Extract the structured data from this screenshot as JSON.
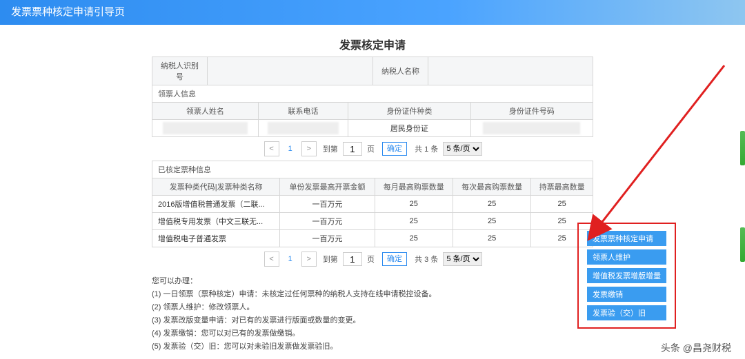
{
  "header": {
    "title": "发票票种核定申请引导页"
  },
  "main": {
    "title": "发票核定申请",
    "taxpayer_row": {
      "id_label": "纳税人识别号",
      "id_value": "",
      "name_label": "纳税人名称",
      "name_value": ""
    },
    "recipient": {
      "section_title": "领票人信息",
      "cols": [
        "领票人姓名",
        "联系电话",
        "身份证件种类",
        "身份证件号码"
      ],
      "row": {
        "name": "",
        "phone": "",
        "id_type": "居民身份证",
        "id_no": ""
      }
    },
    "pager1": {
      "prev": "<",
      "page_num": "1",
      "next": ">",
      "to_label": "到第",
      "to_value": "1",
      "page_unit": "页",
      "confirm": "确定",
      "total_text": "共 1 条",
      "per_page": "5 条/页"
    },
    "approved": {
      "section_title": "已核定票种信息",
      "cols": [
        "发票种类代码|发票种类名称",
        "单份发票最高开票金额",
        "每月最高购票数量",
        "每次最高购票数量",
        "持票最高数量"
      ],
      "rows": [
        {
          "c0": "2016版增值税普通发票（二联...",
          "c1": "一百万元",
          "c2": "25",
          "c3": "25",
          "c4": "25"
        },
        {
          "c0": "增值税专用发票（中文三联无...",
          "c1": "一百万元",
          "c2": "25",
          "c3": "25",
          "c4": "25"
        },
        {
          "c0": "增值税电子普通发票",
          "c1": "一百万元",
          "c2": "25",
          "c3": "25",
          "c4": "25"
        }
      ]
    },
    "pager2": {
      "prev": "<",
      "page_num": "1",
      "next": ">",
      "to_label": "到第",
      "to_value": "1",
      "page_unit": "页",
      "confirm": "确定",
      "total_text": "共 3 条",
      "per_page": "5 条/页"
    },
    "help": {
      "title": "您可以办理：",
      "lines": [
        "(1) 一日领票（票种核定）申请：未核定过任何票种的纳税人支持在线申请税控设备。",
        "(2) 领票人维护：修改领票人。",
        "(3) 发票改版变量申请：对已有的发票进行版面或数量的变更。",
        "(4) 发票缴销：您可以对已有的发票做缴销。",
        "(5) 发票验（交）旧：您可以对未验旧发票做发票验旧。"
      ]
    },
    "actions": {
      "items": [
        "发票票种核定申请",
        "领票人维护",
        "增值税发票增版增量",
        "发票缴销",
        "发票验（交）旧"
      ]
    },
    "watermark": "头条 @昌尧财税"
  }
}
